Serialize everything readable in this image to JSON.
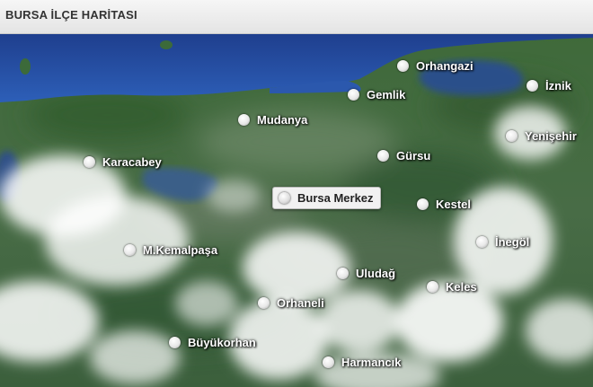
{
  "header": {
    "title": "BURSA İLÇE HARİTASI"
  },
  "districts": [
    {
      "name": "Orhangazi"
    },
    {
      "name": "İznik"
    },
    {
      "name": "Gemlik"
    },
    {
      "name": "Mudanya"
    },
    {
      "name": "Yenişehir"
    },
    {
      "name": "Karacabey"
    },
    {
      "name": "Gürsu"
    },
    {
      "name": "Bursa Merkez",
      "selected": true
    },
    {
      "name": "Kestel"
    },
    {
      "name": "İnegöl"
    },
    {
      "name": "M.Kemalpaşa"
    },
    {
      "name": "Uludağ"
    },
    {
      "name": "Keles"
    },
    {
      "name": "Orhaneli"
    },
    {
      "name": "Büyükorhan"
    },
    {
      "name": "Harmancık"
    }
  ]
}
